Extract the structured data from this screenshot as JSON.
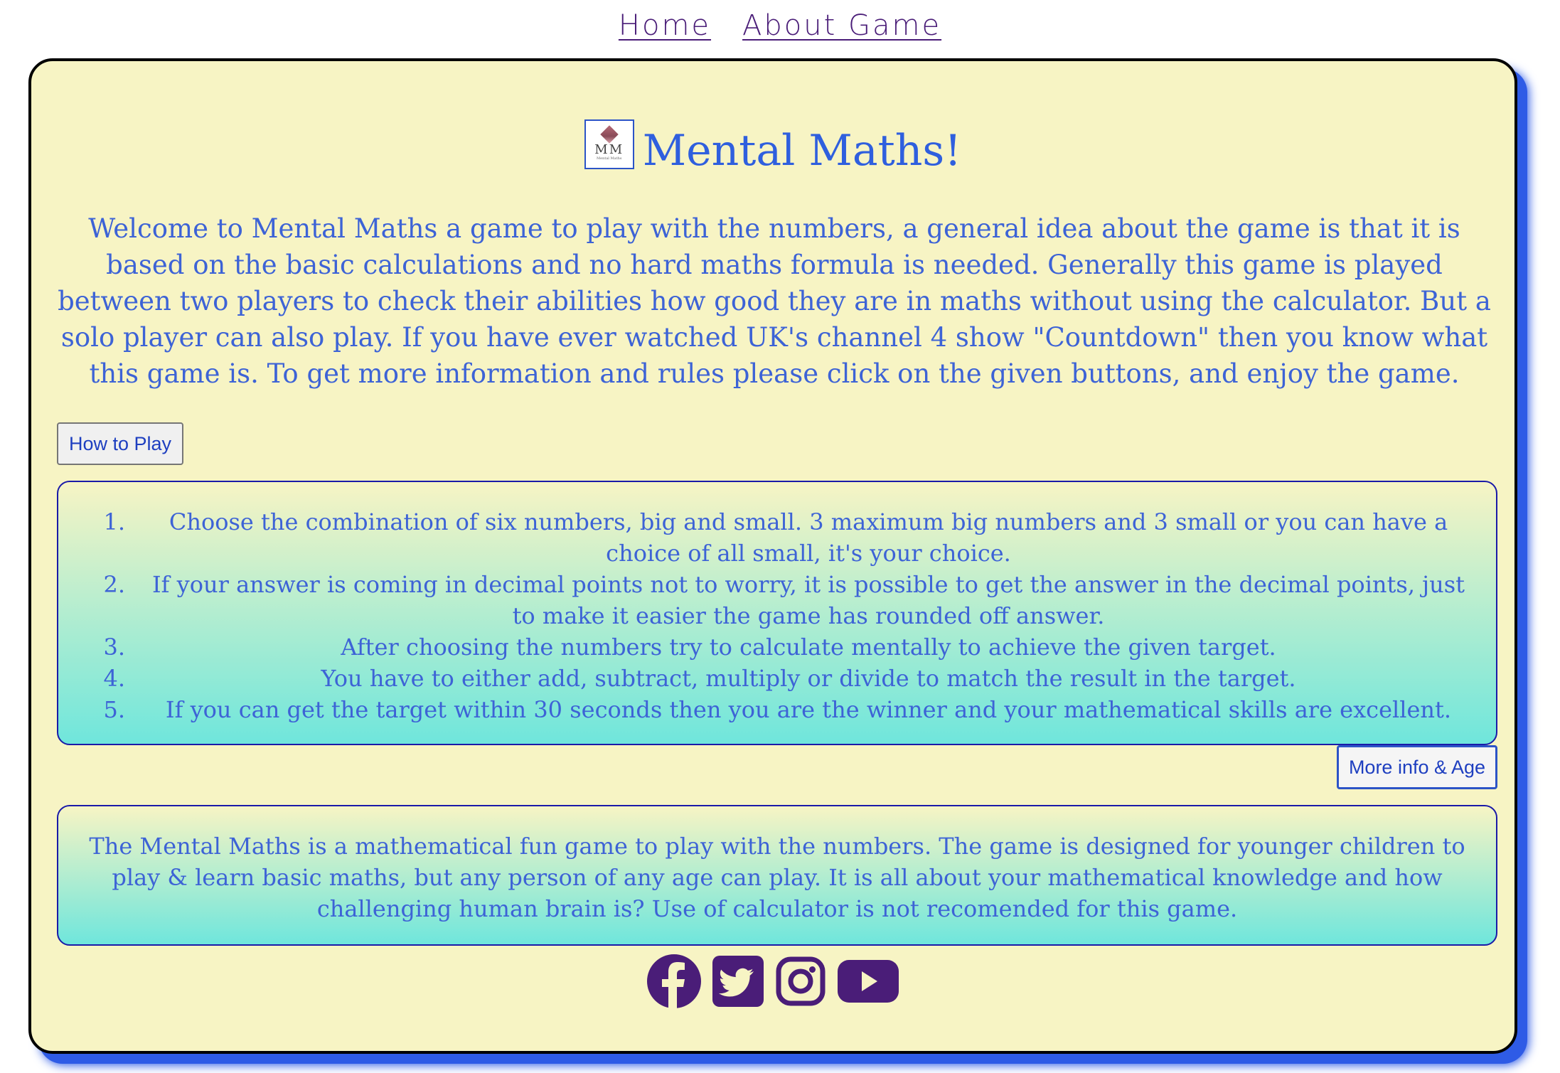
{
  "nav": {
    "home": "Home",
    "about": "About Game"
  },
  "header": {
    "logo_mark": "MM",
    "logo_subtitle": "Mental Maths",
    "title": "Mental Maths!"
  },
  "intro": "Welcome to Mental Maths a game to play with the numbers, a general idea about the game is that it is based on the basic calculations and no hard maths formula is needed. Generally this game is played between two players to check their abilities how good they are in maths without using the calculator. But a solo player can also play. If you have ever watched UK's channel 4 show \"Countdown\" then you know what this game is. To get more information and rules please click on the given buttons, and enjoy the game.",
  "buttons": {
    "how_to_play": "How to Play",
    "more_info": "More info & Age"
  },
  "rules": [
    {
      "num": "1.",
      "text": "Choose the combination of six numbers, big and small. 3 maximum big numbers and 3 small or you can have a choice of all small, it's your choice."
    },
    {
      "num": "2.",
      "text": "If your answer is coming in decimal points not to worry, it is possible to get the answer in the decimal points, just to make it easier the game has rounded off answer."
    },
    {
      "num": "3.",
      "text": "After choosing the numbers try to calculate mentally to achieve the given target."
    },
    {
      "num": "4.",
      "text": "You have to either add, subtract, multiply or divide to match the result in the target."
    },
    {
      "num": "5.",
      "text": "If you can get the target within 30 seconds then you are the winner and your mathematical skills are excellent."
    }
  ],
  "info": "The Mental Maths is a mathematical fun game to play with the numbers. The game is designed for younger children to play & learn basic maths, but any person of any age can play. It is all about your mathematical knowledge and how challenging human brain is? Use of calculator is not recomended for this game.",
  "social": {
    "icons": [
      "facebook-icon",
      "twitter-icon",
      "instagram-icon",
      "youtube-icon"
    ],
    "color": "#4a1d78"
  },
  "colors": {
    "card_background": "#f7f4c4",
    "card_shadow": "#2e5be6",
    "text_blue": "#3d63d6",
    "gradient_bottom": "#6fe6dc",
    "nav_link": "#4a1d78"
  }
}
